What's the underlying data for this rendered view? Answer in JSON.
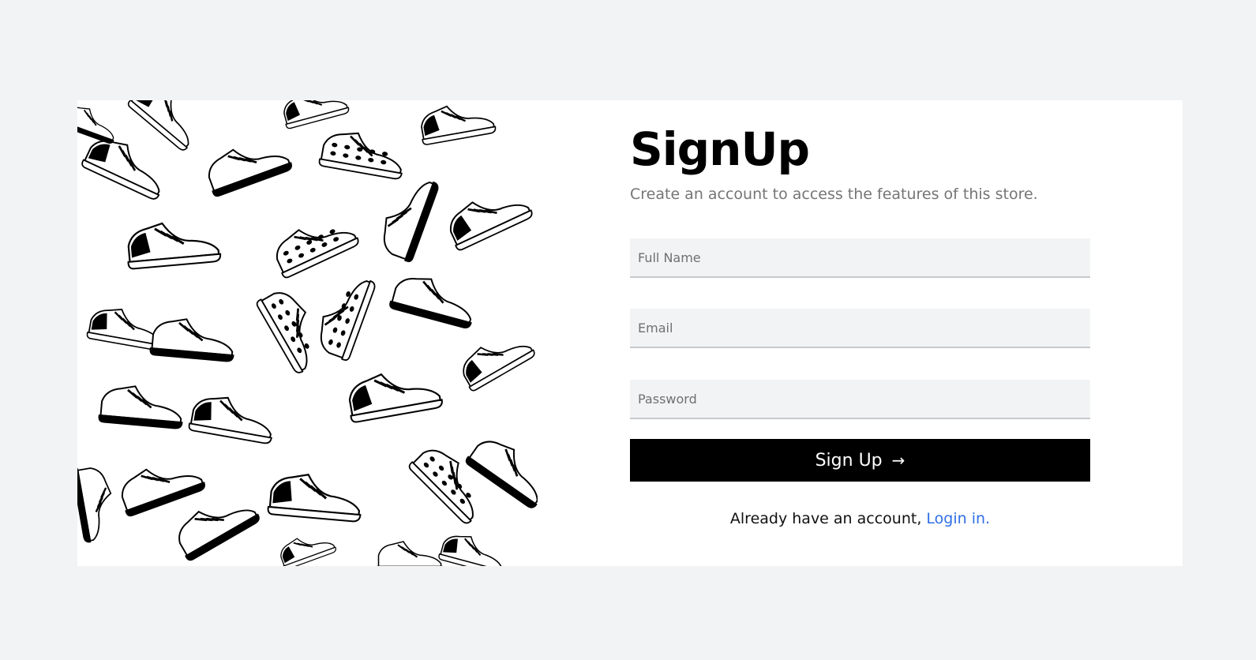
{
  "signup": {
    "title": "SignUp",
    "subtitle": "Create an account to access the features of this store.",
    "fields": {
      "full_name_placeholder": "Full Name",
      "email_placeholder": "Email",
      "password_placeholder": "Password"
    },
    "submit_label": "Sign Up",
    "submit_icon": "arrow-right-icon",
    "login_prompt": "Already have an account,",
    "login_link": "Login in."
  },
  "colors": {
    "page_background": "#f2f3f5",
    "card_background": "#ffffff",
    "button_background": "#000000",
    "link": "#2f6fe4",
    "subtitle_text": "#757575"
  },
  "illustration": {
    "name": "sneakers-pattern",
    "colors": [
      "#000000",
      "#ffffff"
    ]
  }
}
